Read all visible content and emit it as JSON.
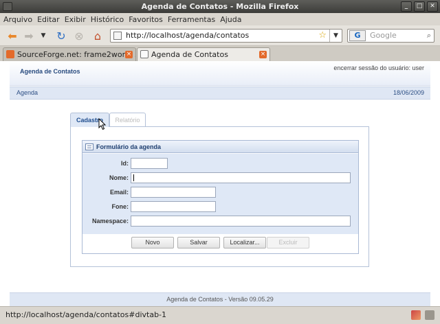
{
  "window": {
    "title": "Agenda de Contatos - Mozilla Firefox"
  },
  "menu": [
    "Arquivo",
    "Editar",
    "Exibir",
    "Histórico",
    "Favoritos",
    "Ferramentas",
    "Ajuda"
  ],
  "nav": {
    "url": "http://localhost/agenda/contatos",
    "search_placeholder": "Google"
  },
  "tabs": [
    {
      "label": "SourceForge.net: frame2work: ..."
    },
    {
      "label": "Agenda de Contatos"
    }
  ],
  "app": {
    "title": "Agenda de Contatos",
    "logout": "encerrar sessão do usuário: user",
    "breadcrumb": "Agenda",
    "date": "18/06/2009",
    "tabs": {
      "cadastro": "Cadastro",
      "relatorio": "Relatório"
    },
    "form": {
      "title": "Formulário da agenda",
      "labels": {
        "id": "Id:",
        "nome": "Nome:",
        "email": "Email:",
        "fone": "Fone:",
        "namespace": "Namespace:"
      },
      "values": {
        "id": "",
        "nome": "",
        "email": "",
        "fone": "",
        "namespace": ""
      },
      "buttons": {
        "novo": "Novo",
        "salvar": "Salvar",
        "localizar": "Localizar...",
        "excluir": "Excluir"
      }
    },
    "footer": "Agenda de Contatos - Versão 09.05.29"
  },
  "status": {
    "text": "http://localhost/agenda/contatos#divtab-1"
  },
  "colors": {
    "accent": "#274a7e",
    "panel_bg": "#dfe8f6",
    "border": "#a9b9d4"
  }
}
